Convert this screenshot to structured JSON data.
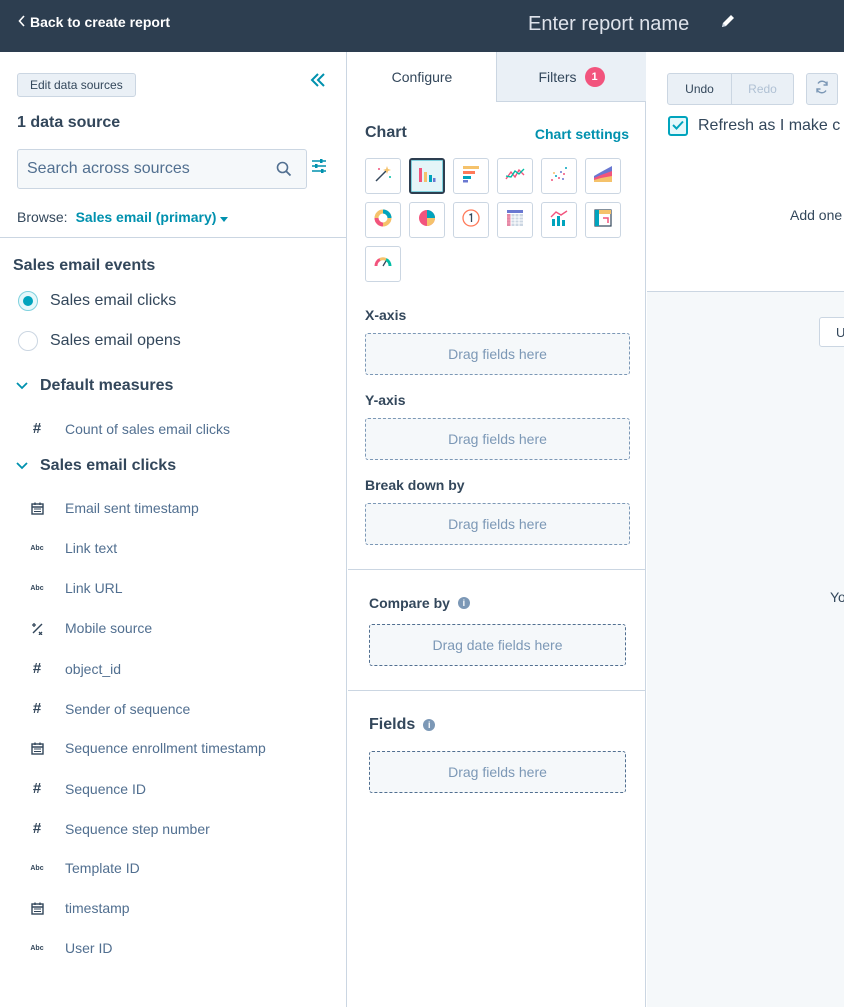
{
  "topbar": {
    "back_label": "Back to create report",
    "report_name_placeholder": "Enter report name"
  },
  "left": {
    "edit_sources_label": "Edit data sources",
    "data_source_count": "1 data source",
    "search_placeholder": "Search across sources",
    "browse_label": "Browse:",
    "browse_value": "Sales email (primary)",
    "events_title": "Sales email events",
    "events": [
      {
        "label": "Sales email clicks",
        "selected": true
      },
      {
        "label": "Sales email opens",
        "selected": false
      }
    ],
    "sections": [
      {
        "title": "Default measures",
        "fields": [
          {
            "icon": "hash-icon",
            "label": "Count of sales email clicks"
          }
        ]
      },
      {
        "title": "Sales email clicks",
        "fields": [
          {
            "icon": "calendar-icon",
            "label": "Email sent timestamp"
          },
          {
            "icon": "abc-icon",
            "label": "Link text"
          },
          {
            "icon": "abc-icon",
            "label": "Link URL"
          },
          {
            "icon": "enum-icon",
            "label": "Mobile source"
          },
          {
            "icon": "hash-icon",
            "label": "object_id"
          },
          {
            "icon": "hash-icon",
            "label": "Sender of sequence"
          },
          {
            "icon": "calendar-icon",
            "label": "Sequence enrollment timestamp"
          },
          {
            "icon": "hash-icon",
            "label": "Sequence ID"
          },
          {
            "icon": "hash-icon",
            "label": "Sequence step number"
          },
          {
            "icon": "abc-icon",
            "label": "Template ID"
          },
          {
            "icon": "calendar-icon",
            "label": "timestamp"
          },
          {
            "icon": "abc-icon",
            "label": "User ID"
          }
        ]
      }
    ]
  },
  "middle": {
    "tabs": [
      {
        "label": "Configure",
        "active": true
      },
      {
        "label": "Filters",
        "badge": "1"
      }
    ],
    "chart_title": "Chart",
    "chart_settings_label": "Chart settings",
    "chart_types": [
      "magic-wand",
      "vertical-bar",
      "horizontal-bar",
      "line",
      "scatter",
      "area",
      "donut",
      "pie",
      "summary",
      "table",
      "combination",
      "pivot",
      "gauge"
    ],
    "xaxis_label": "X-axis",
    "yaxis_label": "Y-axis",
    "breakdown_label": "Break down by",
    "drag_fields": "Drag fields here",
    "compare_by_label": "Compare by",
    "drag_date_fields": "Drag date fields here",
    "fields_label": "Fields",
    "info_glyph": "i"
  },
  "right": {
    "undo_label": "Undo",
    "redo_label": "Redo",
    "refresh_label": "Refresh as I make c",
    "add_one_text": "Add one",
    "stub_button_text": "U",
    "partial_text": "Yo"
  },
  "colors": {
    "topbar": "#2d3e50",
    "accent": "#0091ae",
    "badge": "#f2547d"
  }
}
